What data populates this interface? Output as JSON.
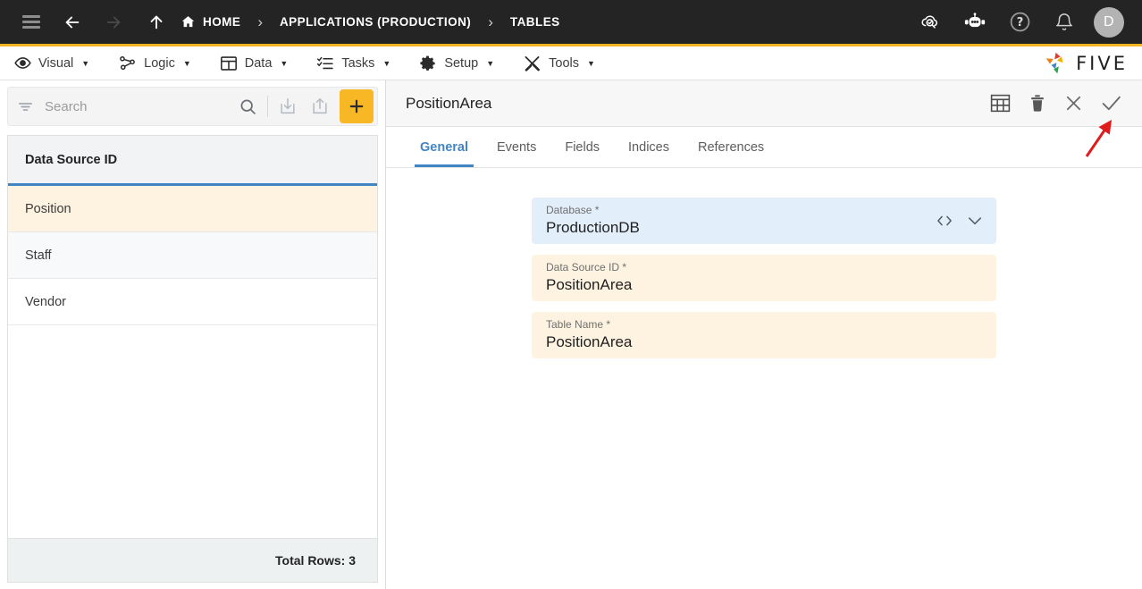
{
  "topbar": {
    "menu_icon": "hamburger-icon",
    "back_icon": "arrow-left-icon",
    "forward_icon": "arrow-right-icon",
    "up_icon": "arrow-up-icon",
    "breadcrumbs": [
      {
        "label": "HOME",
        "icon": "home-icon"
      },
      {
        "label": "APPLICATIONS (PRODUCTION)",
        "icon": ""
      },
      {
        "label": "TABLES",
        "icon": ""
      }
    ],
    "separator": "›",
    "actions": [
      {
        "name": "cloud-search-icon",
        "title": "Cloud Search"
      },
      {
        "name": "robot-icon",
        "title": "Assistant"
      },
      {
        "name": "help-icon",
        "title": "Help"
      },
      {
        "name": "bell-icon",
        "title": "Notifications"
      }
    ],
    "avatar_initial": "D",
    "accent_color": "#f6b522",
    "background_color": "#242424"
  },
  "menubar": {
    "items": [
      {
        "label": "Visual",
        "icon": "eye-icon"
      },
      {
        "label": "Logic",
        "icon": "nodes-icon"
      },
      {
        "label": "Data",
        "icon": "table-icon"
      },
      {
        "label": "Tasks",
        "icon": "checklist-icon"
      },
      {
        "label": "Setup",
        "icon": "gear-icon"
      },
      {
        "label": "Tools",
        "icon": "tools-icon"
      }
    ],
    "caret": "▼",
    "brand": "FIVE"
  },
  "left_panel": {
    "search": {
      "placeholder": "Search",
      "value": "",
      "filter_icon": "filter-icon",
      "search_icon": "search-icon",
      "import_icon": "import-icon",
      "export_icon": "export-icon",
      "add_icon": "plus-icon",
      "add_color": "#f8b825"
    },
    "column_header": "Data Source ID",
    "rows": [
      {
        "label": "Position",
        "selected": true
      },
      {
        "label": "Staff",
        "selected": false
      },
      {
        "label": "Vendor",
        "selected": false
      }
    ],
    "footer_text": "Total Rows: 3",
    "selected_row_color": "#fdf3e0",
    "header_underline_color": "#4285c5"
  },
  "right_panel": {
    "title": "PositionArea",
    "actions": [
      {
        "name": "grid-view-icon",
        "title": "Grid"
      },
      {
        "name": "delete-icon",
        "title": "Delete"
      },
      {
        "name": "close-icon",
        "title": "Close"
      },
      {
        "name": "save-check-icon",
        "title": "Save"
      }
    ],
    "tabs": [
      {
        "label": "General",
        "active": true
      },
      {
        "label": "Events",
        "active": false
      },
      {
        "label": "Fields",
        "active": false
      },
      {
        "label": "Indices",
        "active": false
      },
      {
        "label": "References",
        "active": false
      }
    ],
    "fields": [
      {
        "label": "Database *",
        "value": "ProductionDB",
        "style": "db",
        "icons": [
          "code-icon",
          "chevron-down-icon"
        ]
      },
      {
        "label": "Data Source ID *",
        "value": "PositionArea",
        "style": "cream",
        "icons": []
      },
      {
        "label": "Table Name *",
        "value": "PositionArea",
        "style": "cream",
        "icons": []
      }
    ],
    "annotation": {
      "name": "red-arrow-annotation",
      "color": "#e01b1b",
      "points_to": "save-check-icon"
    }
  }
}
